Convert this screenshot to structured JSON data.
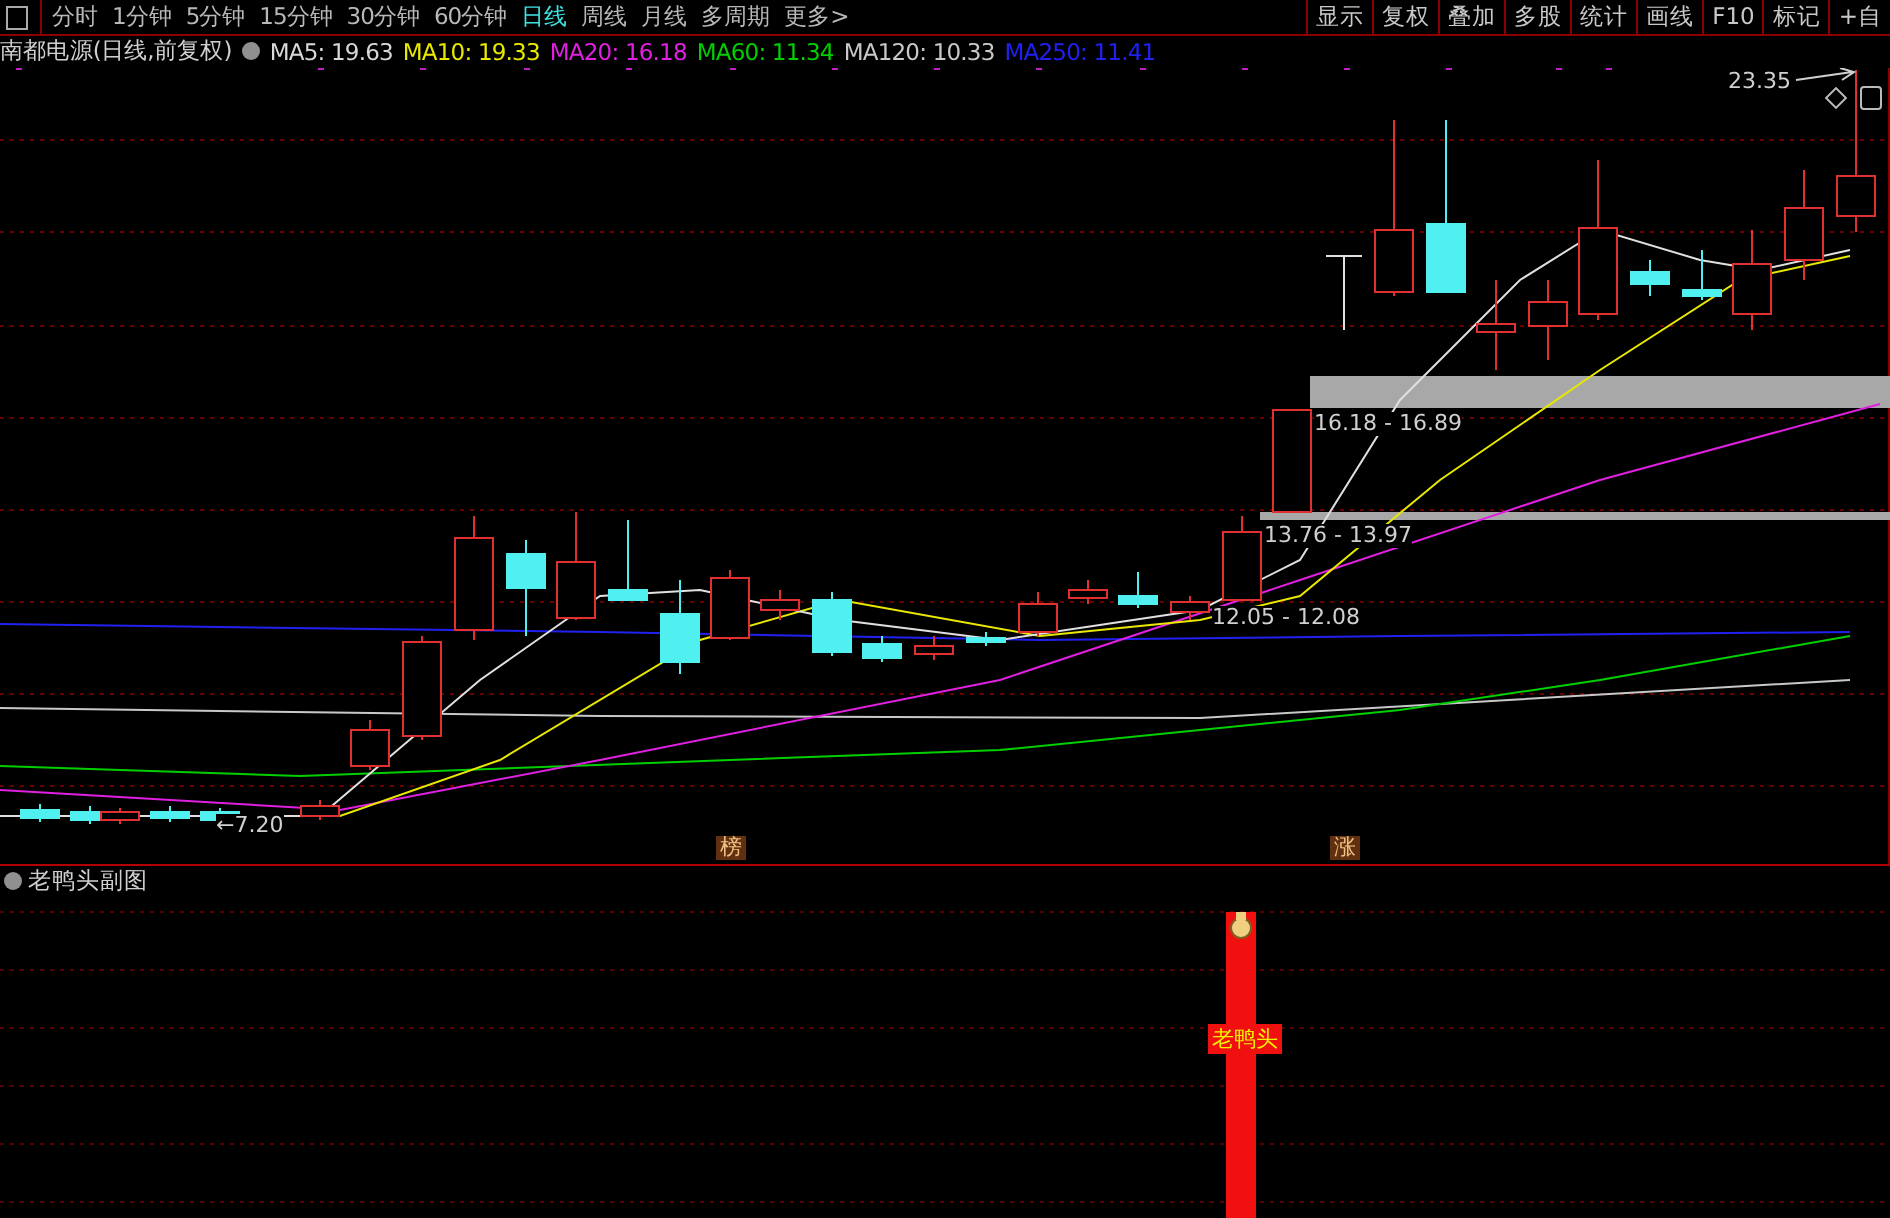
{
  "toolbar": {
    "periods": [
      {
        "label": "分时",
        "selected": false
      },
      {
        "label": "1分钟",
        "selected": false
      },
      {
        "label": "5分钟",
        "selected": false
      },
      {
        "label": "15分钟",
        "selected": false
      },
      {
        "label": "30分钟",
        "selected": false
      },
      {
        "label": "60分钟",
        "selected": false
      },
      {
        "label": "日线",
        "selected": true
      },
      {
        "label": "周线",
        "selected": false
      },
      {
        "label": "月线",
        "selected": false
      },
      {
        "label": "多周期",
        "selected": false
      },
      {
        "label": "更多>",
        "selected": false
      }
    ],
    "buttons": [
      "显示",
      "复权",
      "叠加",
      "多股",
      "统计",
      "画线",
      "F10",
      "标记",
      "+自"
    ]
  },
  "legend": {
    "title": "南都电源(日线,前复权)",
    "indicators": [
      {
        "label": "MA5: 19.63",
        "color": "#d8d8d8"
      },
      {
        "label": "MA10: 19.33",
        "color": "#e8e800"
      },
      {
        "label": "MA20: 16.18",
        "color": "#e020e0"
      },
      {
        "label": "MA60: 11.34",
        "color": "#00d000"
      },
      {
        "label": "MA120: 10.33",
        "color": "#c8c8c8"
      },
      {
        "label": "MA250: 11.41",
        "color": "#2020f0"
      }
    ]
  },
  "chart": {
    "high_label": "23.35",
    "low_label": "←7.20",
    "band_labels": [
      "16.18 - 16.89",
      "13.76 - 13.97",
      "12.05 - 12.08"
    ],
    "markers": [
      "榜",
      "涨"
    ]
  },
  "sub_chart": {
    "title": "老鸭头副图",
    "signal_label": "老鸭头"
  }
}
